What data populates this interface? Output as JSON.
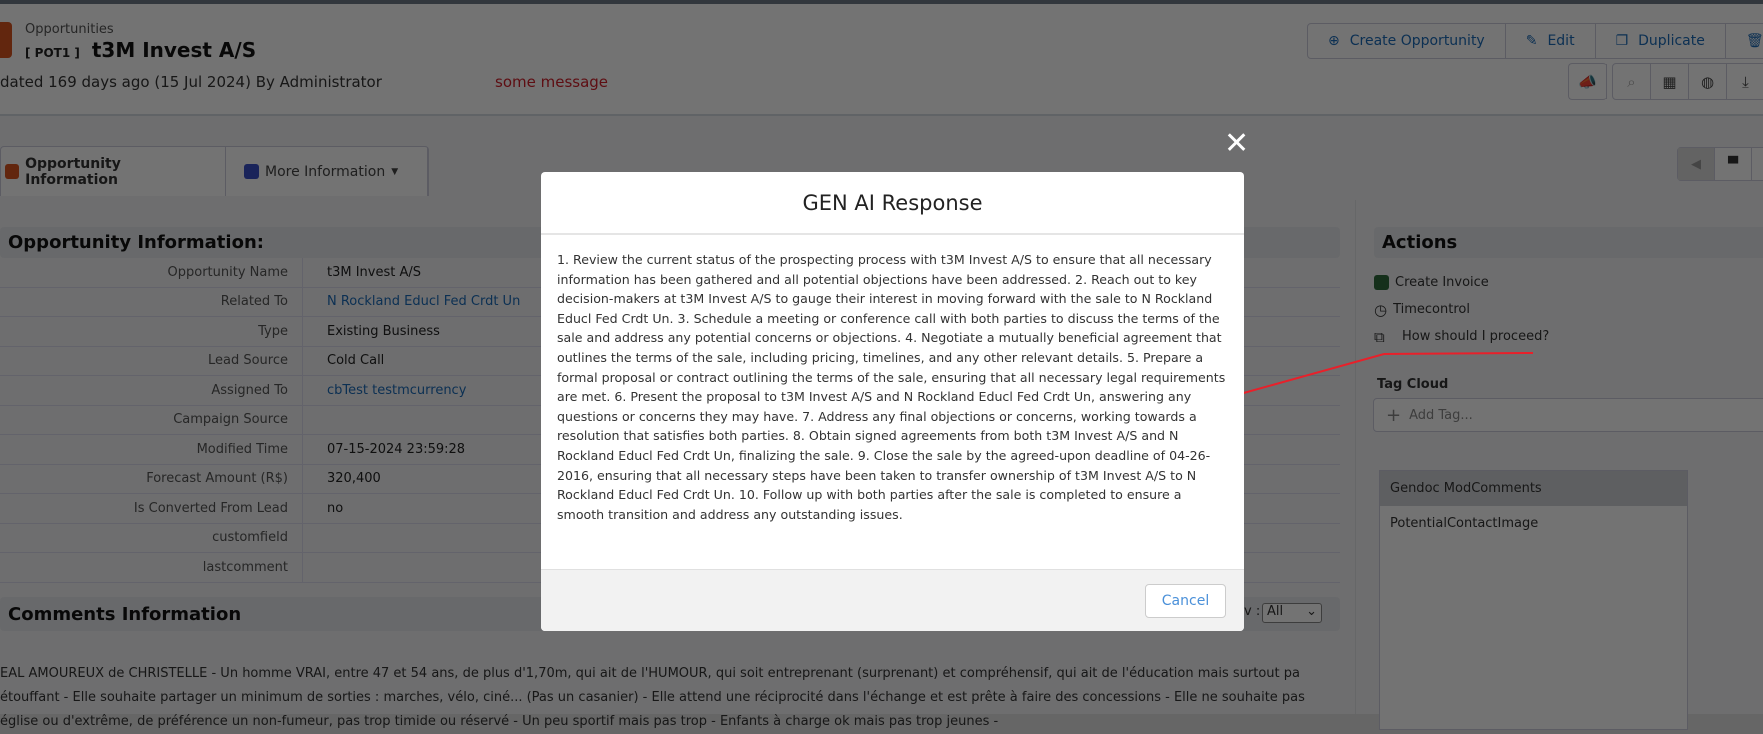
{
  "header": {
    "module": "Opportunities",
    "prefix": "[ POT1 ]",
    "title": "t3M Invest A/S",
    "updated": "dated 169 days ago (15 Jul 2024) By Administrator",
    "message": "some message",
    "buttons": [
      "Create Opportunity",
      "Edit",
      "Duplicate",
      "De"
    ],
    "icon_buttons": [
      "megaphone-icon",
      "search-icon",
      "calendar-icon",
      "globe-icon",
      "download-icon",
      "upload-icon"
    ]
  },
  "tabs": [
    {
      "label": "Opportunity Information"
    },
    {
      "label": "More Information"
    }
  ],
  "section": {
    "title": "Opportunity Information:",
    "fields": [
      {
        "label": "Opportunity Name",
        "value": "t3M Invest A/S"
      },
      {
        "label": "Related To",
        "value": "N Rockland Educl Fed Crdt Un"
      },
      {
        "label": "Type",
        "value": "Existing Business"
      },
      {
        "label": "Lead Source",
        "value": "Cold Call"
      },
      {
        "label": "Assigned To",
        "value": "cbTest testmcurrency"
      },
      {
        "label": "Campaign Source",
        "value": ""
      },
      {
        "label": "Modified Time",
        "value": "07-15-2024 23:59:28"
      },
      {
        "label": "Forecast Amount (R$)",
        "value": "320,400"
      },
      {
        "label": "Is Converted From Lead",
        "value": "no"
      },
      {
        "label": "customfield",
        "value": ""
      },
      {
        "label": "lastcomment",
        "value": ""
      }
    ]
  },
  "comments": {
    "title": "Comments Information",
    "show_label": "v :",
    "show_value": "All",
    "lines": [
      "EAL AMOUREUX de CHRISTELLE - Un homme VRAI, entre 47 et 54 ans, de plus d'1,70m, qui ait de l'HUMOUR, qui soit entreprenant (surprenant) et compréhensif, qui ait de l'éducation mais surtout pa",
      "étouffant - Elle souhaite partager un minimum de sorties : marches, vélo, ciné... (Pas un casanier) - Elle attend une réciprocité dans l'échange et est prête à faire des concessions - Elle ne souhaite pas",
      "église ou d'extrême, de préférence un non-fumeur, pas trop timide ou réservé - Un peu sportif mais pas trop - Enfants à charge ok mais pas trop jeunes -"
    ]
  },
  "actions": {
    "title": "Actions",
    "items": [
      "Create Invoice",
      "Timecontrol",
      "How should I proceed?"
    ]
  },
  "tag_cloud": {
    "title": "Tag Cloud",
    "placeholder": "Add Tag..."
  },
  "gendoc": {
    "header": "Gendoc ModComments",
    "items": [
      "PotentialContactImage"
    ]
  },
  "modal": {
    "title": "GEN AI Response",
    "body": "1. Review the current status of the prospecting process with t3M Invest A/S to ensure that all necessary information has been gathered and all potential objections have been addressed. 2. Reach out to key decision-makers at t3M Invest A/S to gauge their interest in moving forward with the sale to N Rockland Educl Fed Crdt Un. 3. Schedule a meeting or conference call with both parties to discuss the terms of the sale and address any potential concerns or objections. 4. Negotiate a mutually beneficial agreement that outlines the terms of the sale, including pricing, timelines, and any other relevant details. 5. Prepare a formal proposal or contract outlining the terms of the sale, ensuring that all necessary legal requirements are met. 6. Present the proposal to t3M Invest A/S and N Rockland Educl Fed Crdt Un, answering any questions or concerns they may have. 7. Address any final objections or concerns, working towards a resolution that satisfies both parties. 8. Obtain signed agreements from both t3M Invest A/S and N Rockland Educl Fed Crdt Un, finalizing the sale. 9. Close the sale by the agreed-upon deadline of 04-26-2016, ensuring that all necessary steps have been taken to transfer ownership of t3M Invest A/S to N Rockland Educl Fed Crdt Un. 10. Follow up with both parties after the sale is completed to ensure a smooth transition and address any outstanding issues.",
    "cancel": "Cancel",
    "close_icon": "close-icon"
  },
  "colors": {
    "accent": "#1b6bb8",
    "message": "#d0202b",
    "annotation": "#e8202a",
    "module_icon": "#d9541e"
  }
}
